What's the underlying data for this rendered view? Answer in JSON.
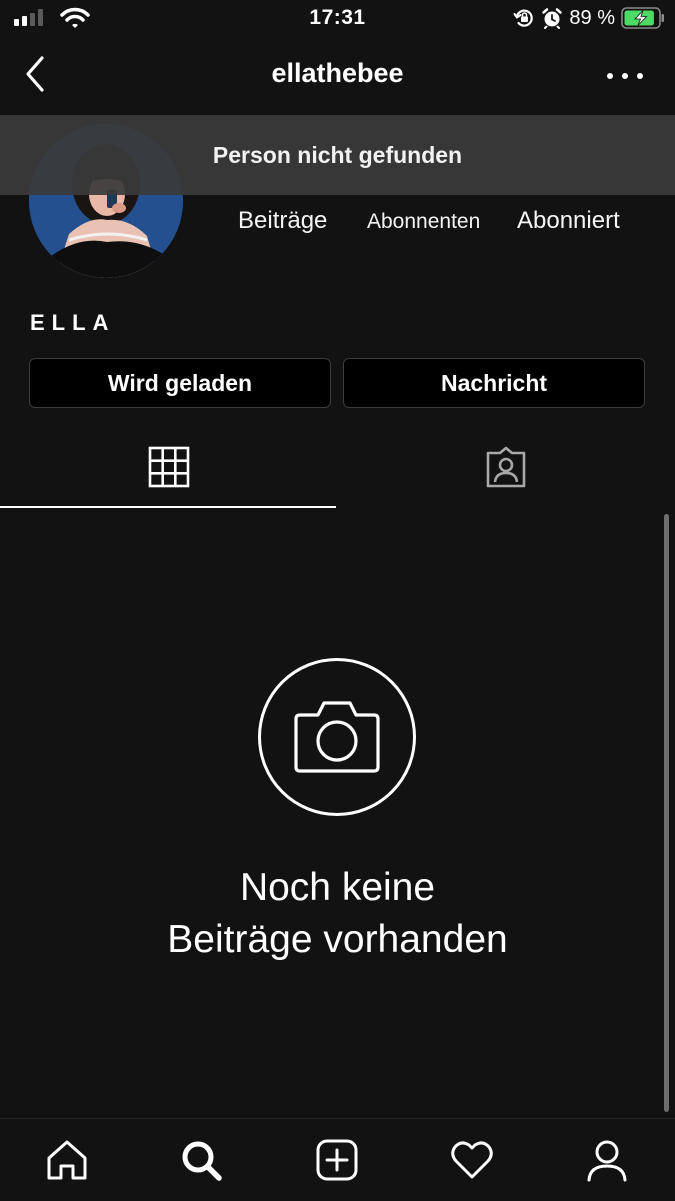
{
  "status_bar": {
    "time": "17:31",
    "battery_percent": "89 %",
    "battery_level": 0.89,
    "signal_bars_active": 2,
    "icons": [
      "signal-icon",
      "wifi-icon",
      "orientation-lock-icon",
      "alarm-icon",
      "battery-charging-icon"
    ]
  },
  "header": {
    "username": "ellathebee",
    "back_icon": "chevron-left-icon",
    "more_icon": "ellipsis-icon"
  },
  "toast": {
    "message": "Person nicht gefunden"
  },
  "profile": {
    "stats": {
      "posts_label": "Beiträge",
      "followers_label": "Abonnenten",
      "following_label": "Abonniert"
    },
    "display_name": "ELLA"
  },
  "actions": {
    "follow_label": "Wird geladen",
    "message_label": "Nachricht"
  },
  "tabs": [
    {
      "icon": "grid-icon",
      "active": true
    },
    {
      "icon": "tagged-person-icon",
      "active": false
    }
  ],
  "empty_state": {
    "icon": "camera-icon",
    "line1": "Noch keine",
    "line2": "Beiträge vorhanden"
  },
  "bottom_nav": [
    "home-icon",
    "search-icon",
    "add-post-icon",
    "heart-icon",
    "profile-icon"
  ],
  "colors": {
    "background": "#121212",
    "button_background": "#000000",
    "toast_background": "#3a3a3a",
    "battery_green": "#4cd964"
  }
}
